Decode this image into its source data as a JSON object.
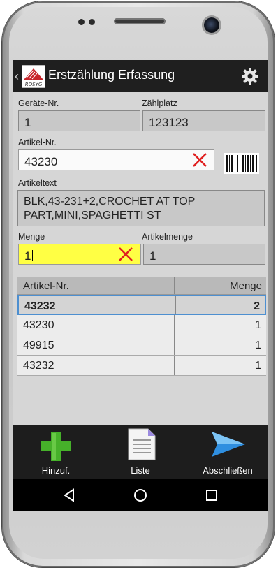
{
  "app": {
    "title": "Erstzählung Erfassung",
    "logo_text": "ROSYG"
  },
  "form": {
    "geraete_label": "Geräte-Nr.",
    "geraete_value": "1",
    "zaehlplatz_label": "Zählplatz",
    "zaehlplatz_value": "123123",
    "artikelnr_label": "Artikel-Nr.",
    "artikelnr_value": "43230",
    "artikeltext_label": "Artikeltext",
    "artikeltext_value": "BLK,43-231+2,CROCHET AT TOP PART,MINI,SPAGHETTI ST",
    "menge_label": "Menge",
    "menge_value": "1",
    "artikelmenge_label": "Artikelmenge",
    "artikelmenge_value": "1"
  },
  "table": {
    "headers": [
      "Artikel-Nr.",
      "Menge"
    ],
    "rows": [
      {
        "artikel": "43232",
        "menge": "2",
        "selected": true
      },
      {
        "artikel": "43230",
        "menge": "1"
      },
      {
        "artikel": "49915",
        "menge": "1"
      },
      {
        "artikel": "43232",
        "menge": "1"
      }
    ]
  },
  "actions": {
    "add_label": "Hinzuf.",
    "list_label": "Liste",
    "finish_label": "Abschließen"
  },
  "icons": {
    "settings": "gear-icon",
    "clear": "close-icon",
    "scan": "barcode-icon",
    "add": "plus-icon",
    "list": "document-icon",
    "finish": "send-icon",
    "nav_back": "back-icon",
    "nav_home": "home-icon",
    "nav_recents": "recents-icon"
  },
  "colors": {
    "titlebar": "#1f1f1f",
    "highlight_field": "#ffff44",
    "clear_x": "#e02020",
    "selected_row_border": "#4d8fd0",
    "add_green": "#46b12a",
    "finish_blue": "#2f8fe0"
  }
}
